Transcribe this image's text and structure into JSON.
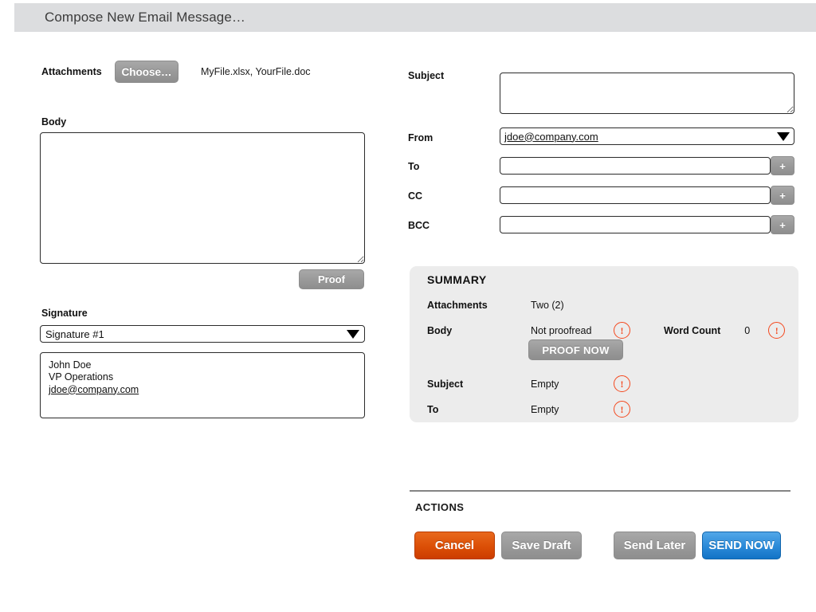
{
  "window": {
    "title": "Compose New Email Message…"
  },
  "left": {
    "attachments": {
      "label": "Attachments",
      "choose_label": "Choose…",
      "files": "MyFile.xlsx, YourFile.doc"
    },
    "body": {
      "label": "Body",
      "value": "",
      "proof_label": "Proof"
    },
    "signature": {
      "label": "Signature",
      "selected": "Signature #1",
      "preview_name": "John Doe",
      "preview_title": "VP Operations",
      "preview_email": "jdoe@company.com"
    }
  },
  "right": {
    "fields": {
      "subject_label": "Subject",
      "subject_value": "",
      "from_label": "From",
      "from_value": "jdoe@company.com",
      "to_label": "To",
      "to_value": "",
      "cc_label": "CC",
      "cc_value": "",
      "bcc_label": "BCC",
      "bcc_value": "",
      "add_label": "+"
    },
    "summary": {
      "title": "SUMMARY",
      "attachments_label": "Attachments",
      "attachments_value": "Two (2)",
      "body_label": "Body",
      "body_value": "Not proofread",
      "word_count_label": "Word Count",
      "word_count_value": "0",
      "proof_now_label": "PROOF NOW",
      "subject_label": "Subject",
      "subject_value": "Empty",
      "to_label": "To",
      "to_value": "Empty",
      "warn_glyph": "!"
    },
    "actions": {
      "title": "ACTIONS",
      "cancel_label": "Cancel",
      "save_draft_label": "Save Draft",
      "send_later_label": "Send Later",
      "send_now_label": "SEND NOW"
    }
  },
  "colors": {
    "titlebar": "#dcdddf",
    "warning": "#f4481e",
    "cancel": "#db4f06",
    "send": "#2b8ad8",
    "grey_button": "#9a9a9a",
    "summary_panel": "#ececec"
  }
}
